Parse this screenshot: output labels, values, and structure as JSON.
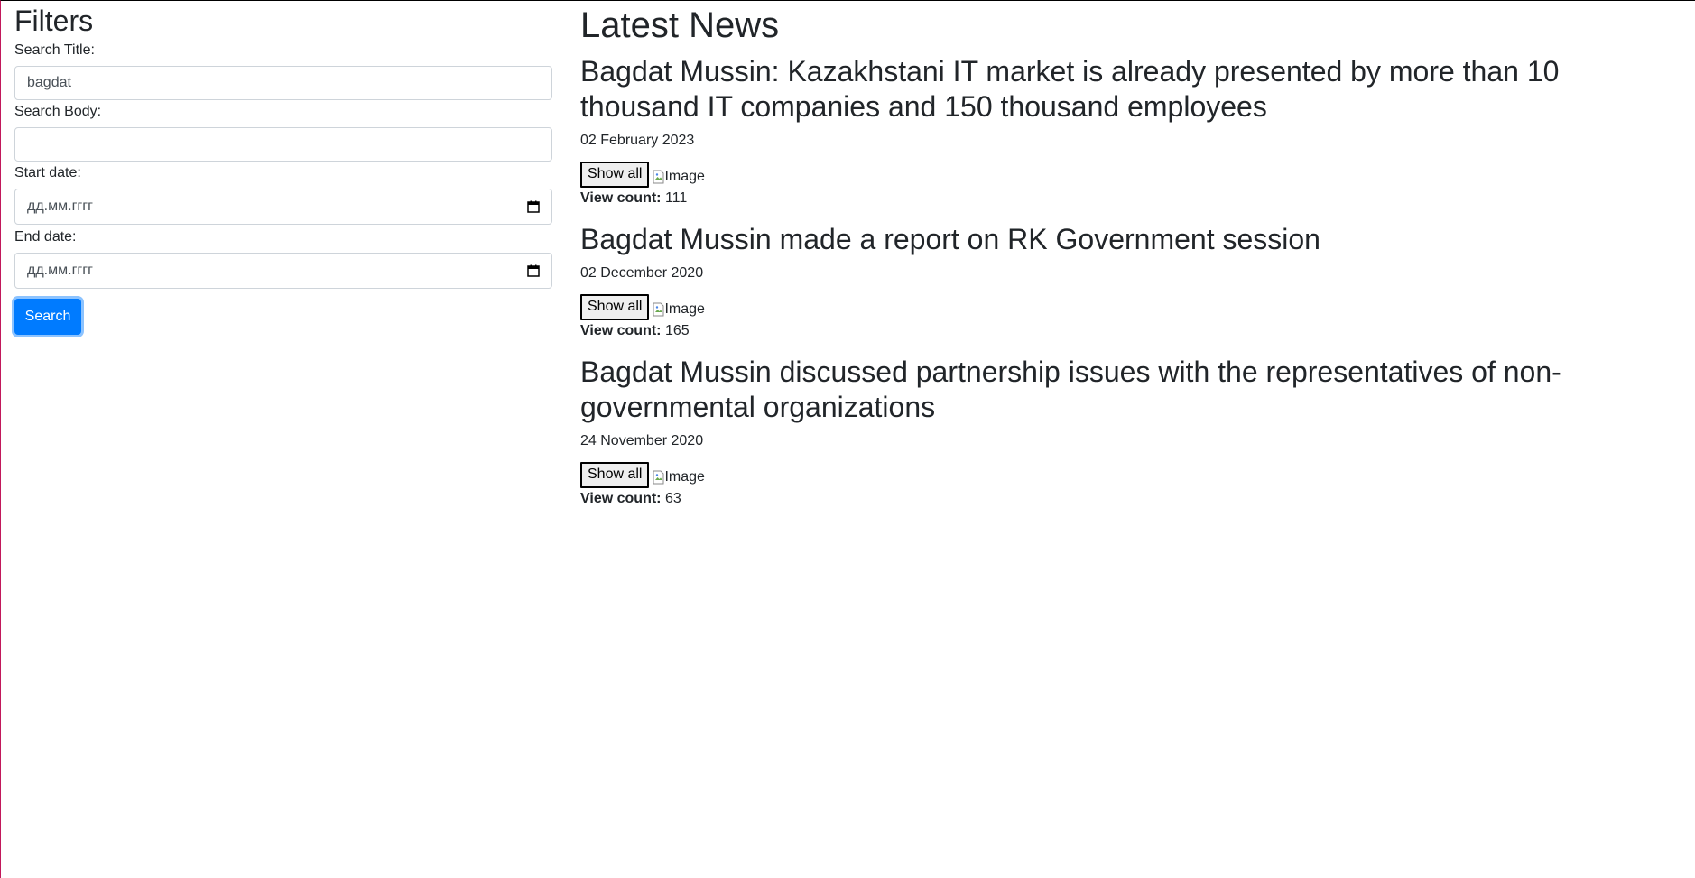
{
  "filters": {
    "heading": "Filters",
    "search_title_label": "Search Title:",
    "search_title_value": "bagdat",
    "search_body_label": "Search Body:",
    "search_body_value": "",
    "start_date_label": "Start date:",
    "start_date_placeholder": "дд.мм.гггг",
    "end_date_label": "End date:",
    "end_date_placeholder": "дд.мм.гггг",
    "search_button": "Search"
  },
  "news": {
    "heading": "Latest News",
    "show_all_label": "Show all",
    "image_alt": "Image",
    "view_count_label": "View count:",
    "items": [
      {
        "title": "Bagdat Mussin: Kazakhstani IT market is already presented by more than 10 thousand IT companies and 150 thousand employees",
        "date": "02 February 2023",
        "view_count": "111"
      },
      {
        "title": "Bagdat Mussin made a report on RK Government session",
        "date": "02 December 2020",
        "view_count": "165"
      },
      {
        "title": "Bagdat Mussin discussed partnership issues with the representatives of non-governmental organizations",
        "date": "24 November 2020",
        "view_count": "63"
      }
    ]
  },
  "colors": {
    "primary": "#007bff",
    "text": "#212529",
    "input_border": "#ced4da"
  },
  "icons": {
    "calendar": "calendar-icon",
    "broken_image": "broken-image-icon"
  }
}
